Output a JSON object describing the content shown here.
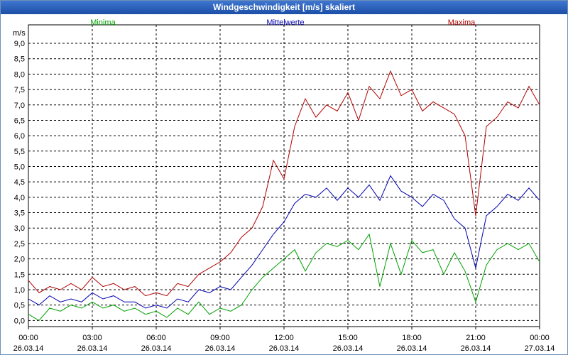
{
  "window": {
    "title": "Windgeschwindigkeit [m/s] skaliert"
  },
  "chart_data": {
    "type": "line",
    "title": "Windgeschwindigkeit [m/s] skaliert",
    "ylabel": "m/s",
    "xlabel": "",
    "ylim": [
      -0.2,
      9.6
    ],
    "xlim": [
      0,
      24
    ],
    "grid": true,
    "legend_placement": "top",
    "y_ticks": [
      "0,0",
      "0,5",
      "1,0",
      "1,5",
      "2,0",
      "2,5",
      "3,0",
      "3,5",
      "4,0",
      "4,5",
      "5,0",
      "5,5",
      "6,0",
      "6,5",
      "7,0",
      "7,5",
      "8,0",
      "8,5",
      "9,0"
    ],
    "x_ticks": [
      {
        "time": "00:00",
        "date": "26.03.14"
      },
      {
        "time": "03:00",
        "date": "26.03.14"
      },
      {
        "time": "06:00",
        "date": "26.03.14"
      },
      {
        "time": "09:00",
        "date": "26.03.14"
      },
      {
        "time": "12:00",
        "date": "26.03.14"
      },
      {
        "time": "15:00",
        "date": "26.03.14"
      },
      {
        "time": "18:00",
        "date": "26.03.14"
      },
      {
        "time": "21:00",
        "date": "26.03.14"
      },
      {
        "time": "00:00",
        "date": "27.03.14"
      }
    ],
    "series": [
      {
        "name": "Minima",
        "color": "#00a000",
        "x": [
          0,
          0.5,
          1,
          1.5,
          2,
          2.5,
          3,
          3.5,
          4,
          4.5,
          5,
          5.5,
          6,
          6.5,
          7,
          7.5,
          8,
          8.5,
          9,
          9.5,
          10,
          10.5,
          11,
          11.5,
          12,
          12.5,
          13,
          13.5,
          14,
          14.5,
          15,
          15.5,
          16,
          16.5,
          17,
          17.5,
          18,
          18.5,
          19,
          19.5,
          20,
          20.5,
          21,
          21.5,
          22,
          22.5,
          23,
          23.5,
          24
        ],
        "values": [
          0.2,
          0.0,
          0.4,
          0.3,
          0.5,
          0.4,
          0.6,
          0.4,
          0.5,
          0.3,
          0.4,
          0.2,
          0.3,
          0.1,
          0.4,
          0.2,
          0.6,
          0.2,
          0.4,
          0.3,
          0.5,
          1.0,
          1.4,
          1.7,
          2.0,
          2.3,
          1.6,
          2.2,
          2.5,
          2.4,
          2.6,
          2.3,
          2.8,
          1.1,
          2.5,
          1.5,
          2.6,
          2.2,
          2.3,
          1.5,
          2.2,
          1.6,
          0.6,
          1.8,
          2.3,
          2.5,
          2.3,
          2.5,
          1.9
        ]
      },
      {
        "name": "Mittelwerte",
        "color": "#0000b0",
        "x": [
          0,
          0.5,
          1,
          1.5,
          2,
          2.5,
          3,
          3.5,
          4,
          4.5,
          5,
          5.5,
          6,
          6.5,
          7,
          7.5,
          8,
          8.5,
          9,
          9.5,
          10,
          10.5,
          11,
          11.5,
          12,
          12.5,
          13,
          13.5,
          14,
          14.5,
          15,
          15.5,
          16,
          16.5,
          17,
          17.5,
          18,
          18.5,
          19,
          19.5,
          20,
          20.5,
          21,
          21.5,
          22,
          22.5,
          23,
          23.5,
          24
        ],
        "values": [
          0.7,
          0.5,
          0.8,
          0.6,
          0.7,
          0.6,
          0.9,
          0.7,
          0.8,
          0.6,
          0.6,
          0.4,
          0.5,
          0.4,
          0.7,
          0.6,
          1.0,
          0.9,
          1.1,
          1.0,
          1.4,
          1.8,
          2.3,
          2.8,
          3.2,
          3.8,
          4.1,
          4.0,
          4.3,
          3.9,
          4.3,
          4.0,
          4.4,
          3.9,
          4.7,
          4.2,
          4.0,
          3.7,
          4.1,
          3.9,
          3.3,
          3.0,
          1.7,
          3.4,
          3.7,
          4.1,
          3.9,
          4.3,
          3.9
        ]
      },
      {
        "name": "Maxima",
        "color": "#b00000",
        "x": [
          0,
          0.5,
          1,
          1.5,
          2,
          2.5,
          3,
          3.5,
          4,
          4.5,
          5,
          5.5,
          6,
          6.5,
          7,
          7.5,
          8,
          8.5,
          9,
          9.5,
          10,
          10.5,
          11,
          11.5,
          12,
          12.5,
          13,
          13.5,
          14,
          14.5,
          15,
          15.5,
          16,
          16.5,
          17,
          17.5,
          18,
          18.5,
          19,
          19.5,
          20,
          20.5,
          21,
          21.5,
          22,
          22.5,
          23,
          23.5,
          24
        ],
        "values": [
          1.3,
          0.9,
          1.1,
          1.0,
          1.2,
          1.0,
          1.4,
          1.1,
          1.2,
          1.0,
          1.1,
          0.8,
          0.9,
          0.8,
          1.2,
          1.1,
          1.5,
          1.7,
          1.9,
          2.2,
          2.7,
          3.0,
          3.7,
          5.2,
          4.6,
          6.3,
          7.2,
          6.6,
          7.0,
          6.8,
          7.4,
          6.5,
          7.6,
          7.2,
          8.1,
          7.3,
          7.5,
          6.8,
          7.1,
          6.9,
          6.7,
          6.0,
          3.4,
          6.3,
          6.6,
          7.1,
          6.9,
          7.6,
          7.0
        ]
      }
    ]
  }
}
